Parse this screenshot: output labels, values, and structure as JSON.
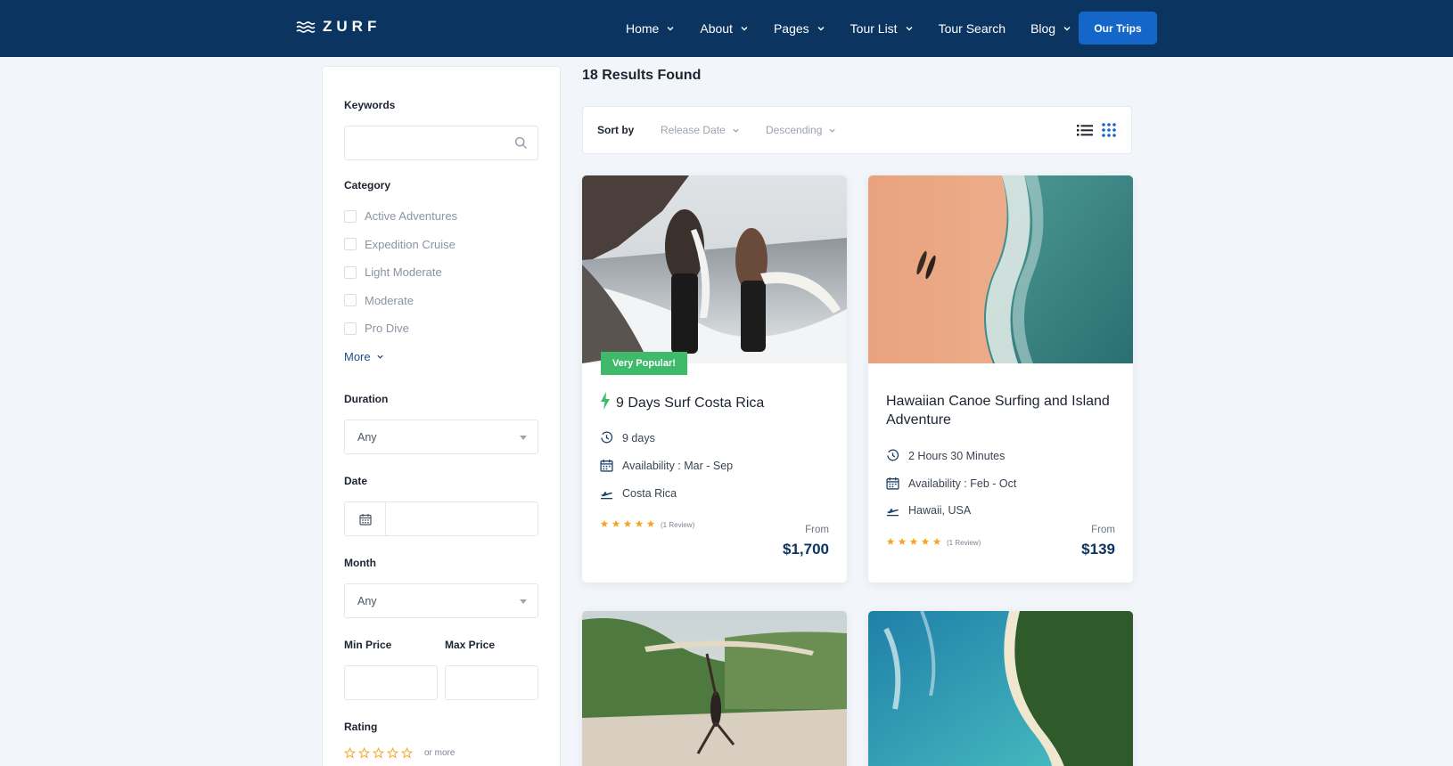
{
  "brand": {
    "name": "ZURF"
  },
  "nav": {
    "items": [
      {
        "label": "Home",
        "dropdown": true
      },
      {
        "label": "About",
        "dropdown": true
      },
      {
        "label": "Pages",
        "dropdown": true
      },
      {
        "label": "Tour List",
        "dropdown": true
      },
      {
        "label": "Tour Search",
        "dropdown": false
      },
      {
        "label": "Blog",
        "dropdown": true
      }
    ],
    "cta_label": "Our Trips"
  },
  "filters": {
    "keywords_label": "Keywords",
    "keywords_value": "",
    "category_label": "Category",
    "categories": [
      "Active Adventures",
      "Expedition Cruise",
      "Light Moderate",
      "Moderate",
      "Pro Dive"
    ],
    "more_label": "More",
    "duration_label": "Duration",
    "duration_value": "Any",
    "date_label": "Date",
    "date_value": "",
    "month_label": "Month",
    "month_value": "Any",
    "min_price_label": "Min Price",
    "max_price_label": "Max Price",
    "rating_label": "Rating",
    "rating_suffix": "or more"
  },
  "results": {
    "count_text": "18 Results Found",
    "sort_label": "Sort by",
    "sort_field": "Release Date",
    "sort_order": "Descending"
  },
  "tours": [
    {
      "title": "9 Days Surf Costa Rica",
      "badge": "Very Popular!",
      "duration": "9 days",
      "availability": "Availability : Mar - Sep",
      "location": "Costa Rica",
      "rating": 5,
      "reviews": "(1 Review)",
      "from_label": "From",
      "price": "$1,700"
    },
    {
      "title": "Hawaiian Canoe Surfing and Island Adventure",
      "badge": "",
      "duration": "2 Hours 30 Minutes",
      "availability": "Availability : Feb - Oct",
      "location": "Hawaii, USA",
      "rating": 5,
      "reviews": "(1 Review)",
      "from_label": "From",
      "price": "$139"
    }
  ],
  "colors": {
    "nav_bg": "#0b3560",
    "accent": "#1467c8",
    "badge_green": "#3fb96a",
    "star": "#f5a623",
    "price": "#0b3560"
  },
  "icons": {
    "search": "search-icon",
    "calendar": "calendar-icon",
    "clock": "clock-icon",
    "plane": "plane-icon",
    "bolt": "bolt-icon",
    "list_view": "list-view-icon",
    "grid_view": "grid-view-icon"
  }
}
